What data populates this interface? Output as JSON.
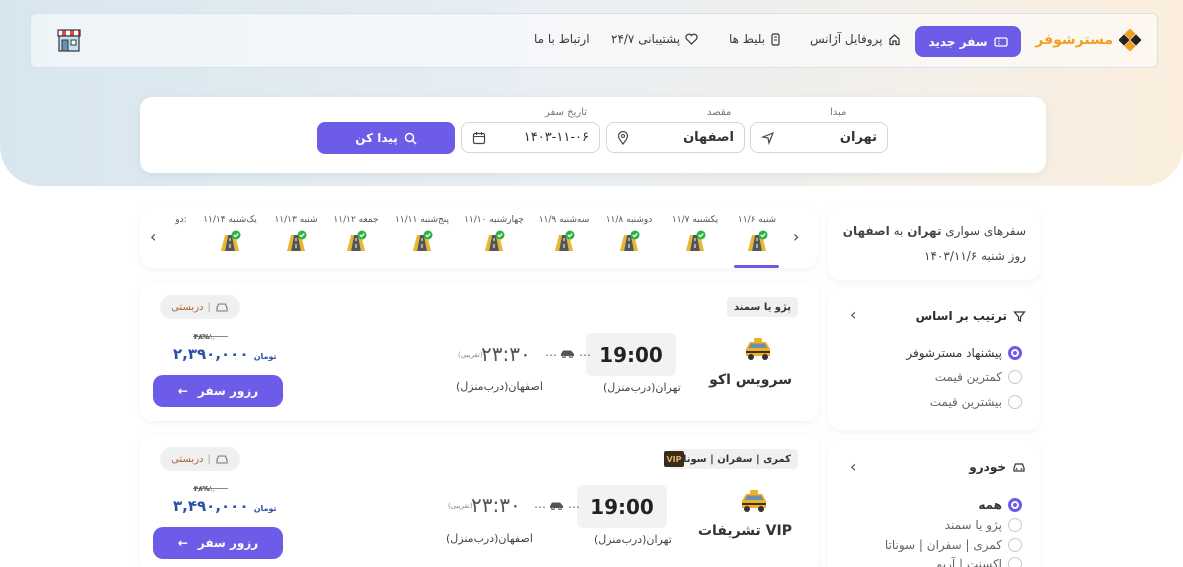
{
  "header": {
    "logo_text": "مسترشوفر",
    "new_trip_label": "سفر جدید",
    "nav": {
      "agency_profile": "پروفایل آژانس",
      "tickets": "بلیط ها",
      "support": "پشتیبانی ۲۴/۷",
      "contact": "ارتباط با ما"
    }
  },
  "search": {
    "origin_label": "مبدا",
    "origin_value": "تهران",
    "destination_label": "مقصد",
    "destination_value": "اصفهان",
    "date_label": "تاریخ سفر",
    "date_value": "۱۴۰۳-۱۱-۰۶",
    "find_label": "پیدا کن"
  },
  "dates": [
    {
      "label": "شنبه ۱۱/۶"
    },
    {
      "label": "یکشنبه ۱۱/۷"
    },
    {
      "label": "دوشنبه ۱۱/۸"
    },
    {
      "label": "سه‌شنبه ۱۱/۹"
    },
    {
      "label": "چهارشنبه ۱۱/۱۰"
    },
    {
      "label": "پنج‌شنبه ۱۱/۱۱"
    },
    {
      "label": "جمعه ۱۱/۱۲"
    },
    {
      "label": "شنبه ۱۱/۱۳"
    },
    {
      "label": "یک‌شنبه ۱۱/۱۴"
    },
    {
      "label": "دو:"
    }
  ],
  "summary": {
    "prefix": "سفرهای سواری",
    "from": "تهران",
    "to_word": "به",
    "to": "اصفهان",
    "date_line": "روز شنبه  ۱۴۰۳/۱۱/۶"
  },
  "sort": {
    "title": "ترتیب بر اساس",
    "options": [
      "پیشنهاد مسترشوفر",
      "کمترین قیمت",
      "بیشترین قیمت"
    ],
    "selected_index": 0
  },
  "vehicle_filter": {
    "title": "خودرو",
    "options": [
      "همه",
      "پژو یا سمند",
      "کمری | سفران | سوناتا",
      "اکسنت | آریو"
    ],
    "selected_index": 0
  },
  "trips": [
    {
      "vehicle": "پژو یا سمند",
      "vip": "",
      "service": "سرویس اکو",
      "departure_time": "19:00",
      "arrival_time": "۲۳:۳۰",
      "approx_label": "(تقریبی)",
      "origin_place": "تهران(درب‌منزل)",
      "dest_place": "اصفهان(درب‌منزل)",
      "tag": "دربستی",
      "old_price": "۴,۵۷۸,۰۰۰",
      "discount": "۴۸%",
      "price": "۲,۳۹۰,۰۰۰",
      "currency": "تومان",
      "reserve_label": "رزور سفر"
    },
    {
      "vehicle": "کمری | سفران | سوناتا",
      "vip": "VIP",
      "service": "تشریفات VIP",
      "departure_time": "19:00",
      "arrival_time": "۲۳:۳۰",
      "approx_label": "(تقریبی)",
      "origin_place": "تهران(درب‌منزل)",
      "dest_place": "اصفهان(درب‌منزل)",
      "tag": "دربستی",
      "old_price": "۶,۶۸۸,۰۰۰",
      "discount": "۴۸%",
      "price": "۳,۴۹۰,۰۰۰",
      "currency": "تومان",
      "reserve_label": "رزور سفر"
    }
  ],
  "colors": {
    "accent": "#6c5ce7",
    "price": "#2c4fa8",
    "logo": "#f0a020"
  }
}
